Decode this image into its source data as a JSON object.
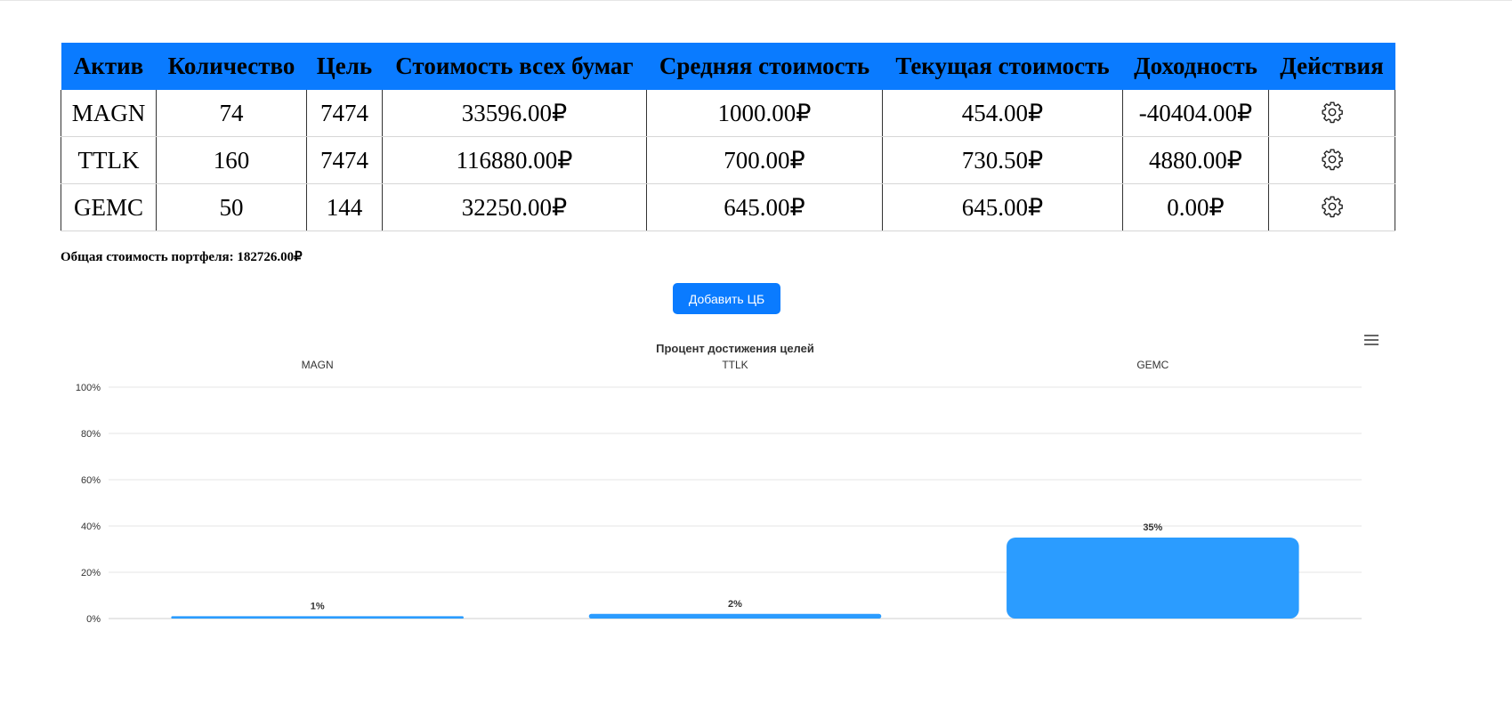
{
  "table": {
    "headers": [
      "Актив",
      "Количество",
      "Цель",
      "Стоимость всех бумаг",
      "Средняя стоимость",
      "Текущая стоимость",
      "Доходность",
      "Действия"
    ],
    "rows": [
      {
        "asset": "MAGN",
        "quantity": "74",
        "target": "7474",
        "total_value": "33596.00₽",
        "avg_price": "1000.00₽",
        "current_price": "454.00₽",
        "profit": "-40404.00₽",
        "action_icon": "gear-icon"
      },
      {
        "asset": "TTLK",
        "quantity": "160",
        "target": "7474",
        "total_value": "116880.00₽",
        "avg_price": "700.00₽",
        "current_price": "730.50₽",
        "profit": "4880.00₽",
        "action_icon": "gear-icon"
      },
      {
        "asset": "GEMC",
        "quantity": "50",
        "target": "144",
        "total_value": "32250.00₽",
        "avg_price": "645.00₽",
        "current_price": "645.00₽",
        "profit": "0.00₽",
        "action_icon": "gear-icon"
      }
    ]
  },
  "summary": {
    "total_text": "Общая стоимость портфеля: 182726.00₽"
  },
  "actions": {
    "add_label": "Добавить ЦБ"
  },
  "colors": {
    "header_bg": "#0a7bff",
    "button_bg": "#0a7bff",
    "bar": "#2b9cff"
  },
  "chart_data": {
    "type": "bar",
    "title": "Процент достижения целей",
    "categories": [
      "MAGN",
      "TTLK",
      "GEMC"
    ],
    "values": [
      1,
      2,
      35
    ],
    "data_labels": [
      "1%",
      "2%",
      "35%"
    ],
    "y_ticks": [
      "0%",
      "20%",
      "40%",
      "60%",
      "80%",
      "100%"
    ],
    "ylim": [
      0,
      100
    ],
    "grid": true,
    "category_labels_position": "top",
    "menu_icon": "hamburger-menu-icon"
  }
}
